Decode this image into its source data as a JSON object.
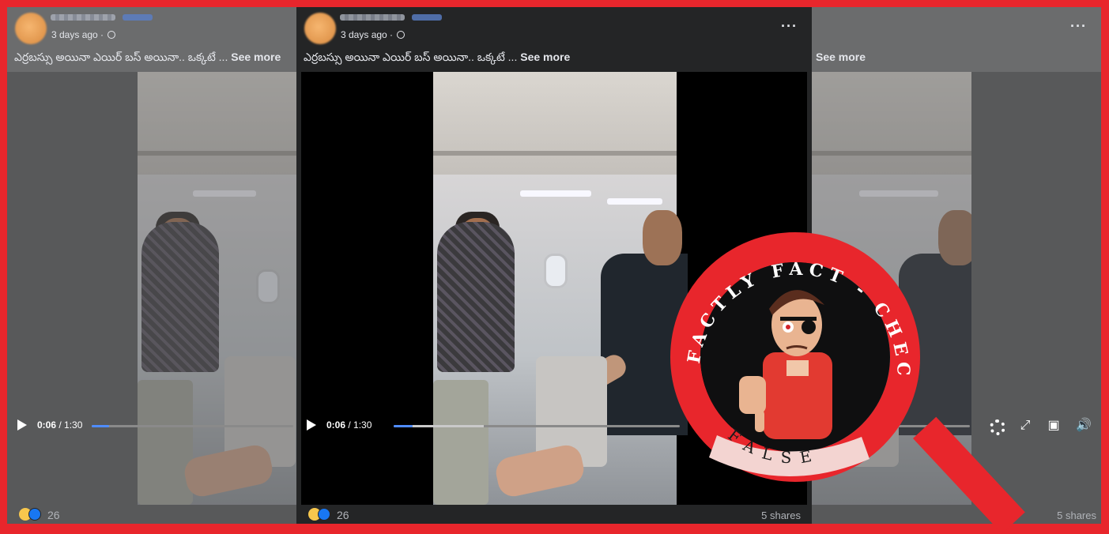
{
  "posts": {
    "time_meta": "3 days ago ·",
    "caption": "ఎర్రబస్సు అయినా ఎయిర్ బస్ అయినా.. ఒక్కటే ... ",
    "see_more": "See more",
    "more_menu": "···",
    "video": {
      "time_current": "0:06",
      "time_total": " / 1:30",
      "progress_fraction": 0.05,
      "buffered_fraction": 0.31
    },
    "reaction_count": "26",
    "shares": "5 shares"
  },
  "stamp": {
    "top_text": "FACTLY FACT - CHECK",
    "verdict": "FALSE"
  },
  "colors": {
    "brand_red": "#e8262c",
    "facebook_blue": "#1877f2",
    "progress_blue": "#4f8cff"
  },
  "icons": [
    "globe-icon",
    "play-icon",
    "settings-icon",
    "fullscreen-icon",
    "miniplayer-icon",
    "volume-icon",
    "haha-reaction-icon",
    "like-reaction-icon",
    "more-icon"
  ]
}
